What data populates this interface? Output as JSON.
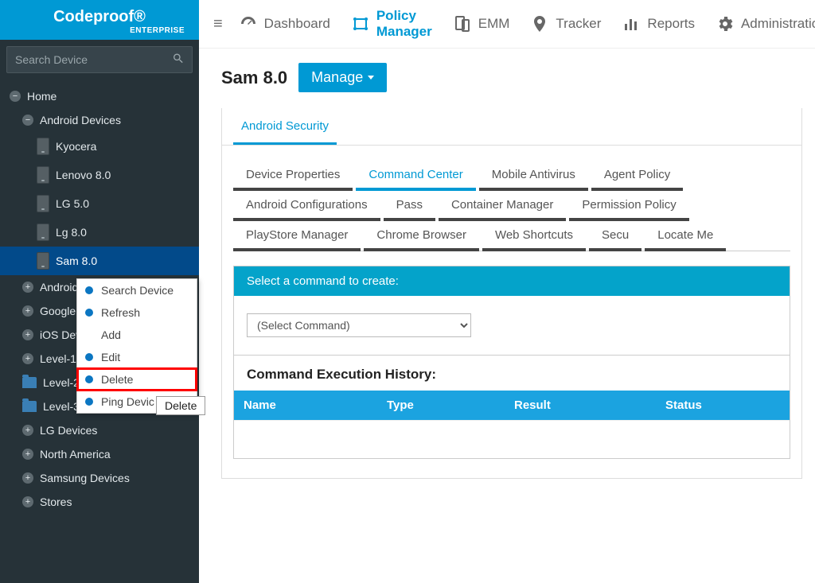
{
  "brand": {
    "title": "Codeproof®",
    "subtitle": "ENTERPRISE"
  },
  "search": {
    "placeholder": "Search Device"
  },
  "tree": {
    "home": "Home",
    "android_devices": "Android Devices",
    "devices": [
      "Kyocera",
      "Lenovo 8.0",
      "LG 5.0",
      "Lg 8.0",
      "Sam 8.0"
    ],
    "nodes": [
      "Android Te",
      "Google tes",
      "iOS Device",
      "Level-1"
    ],
    "folders": [
      "Level-2",
      "Level-3"
    ],
    "nodes2": [
      "LG Devices",
      "North America",
      "Samsung Devices",
      "Stores"
    ]
  },
  "context_menu": {
    "items": [
      "Search Device",
      "Refresh",
      "Add",
      "Edit",
      "Delete",
      "Ping Devic"
    ],
    "tooltip": "Delete"
  },
  "topnav": {
    "items": [
      "Dashboard",
      "Policy Manager",
      "EMM",
      "Tracker",
      "Reports",
      "Administration"
    ]
  },
  "page": {
    "title": "Sam 8.0",
    "manage_label": "Manage"
  },
  "super_tab": "Android Security",
  "sub_tabs_row1": [
    "Device Properties",
    "Command Center",
    "Mobile Antivirus",
    "Agent Policy",
    "Android Configurations",
    "Pass"
  ],
  "sub_tabs_row2": [
    "Container Manager",
    "Permission Policy",
    "PlayStore Manager",
    "Chrome Browser",
    "Web Shortcuts",
    "Secu"
  ],
  "sub_tabs_row3": [
    "Locate Me"
  ],
  "command_center": {
    "header": "Select a command to create:",
    "select_placeholder": "(Select Command)"
  },
  "history": {
    "title": "Command Execution History:",
    "columns": [
      "Name",
      "Type",
      "Result",
      "Status"
    ]
  },
  "colors": {
    "accent": "#0099d4",
    "sidebar": "#263238"
  }
}
